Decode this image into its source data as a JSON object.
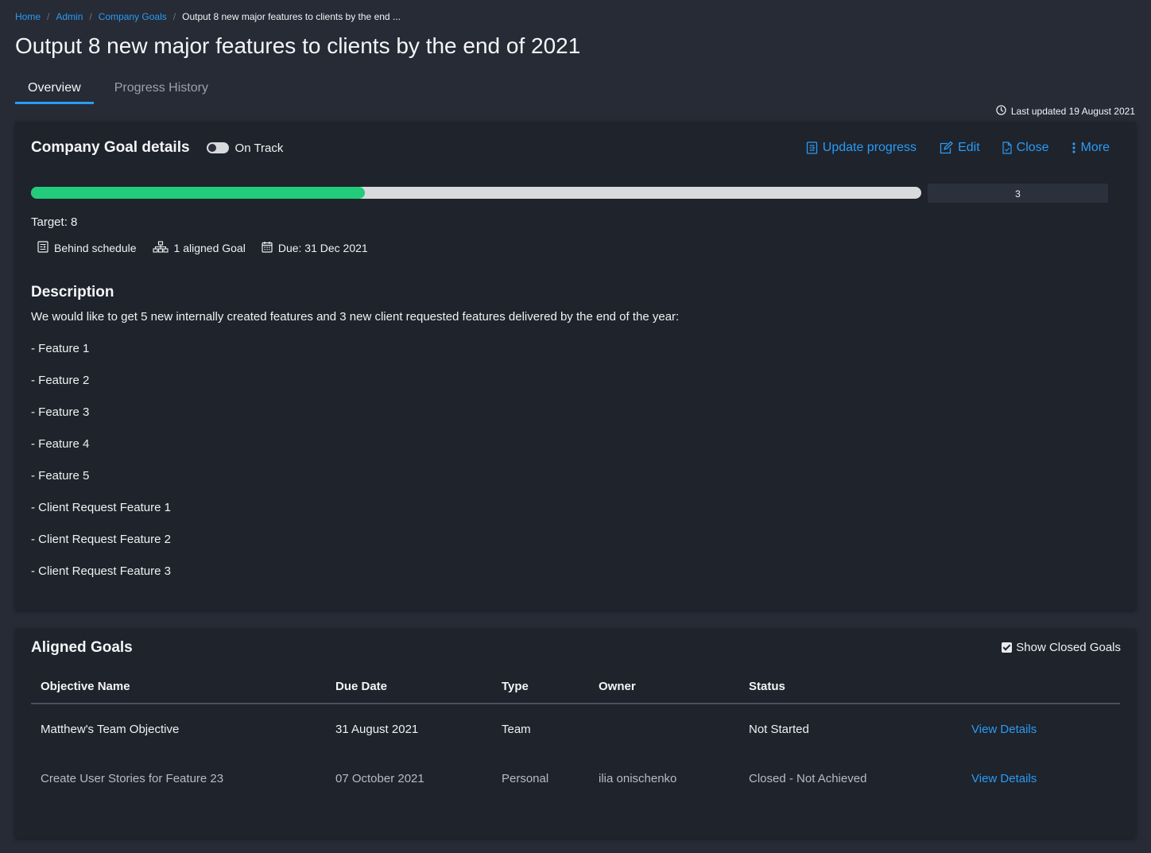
{
  "breadcrumb": {
    "home": "Home",
    "admin": "Admin",
    "company_goals": "Company Goals",
    "current": "Output 8 new major features to clients by the end ..."
  },
  "title": "Output 8 new major features to clients by the end of 2021",
  "tabs": [
    {
      "label": "Overview",
      "active": true
    },
    {
      "label": "Progress History",
      "active": false
    }
  ],
  "last_updated": "Last updated 19 August 2021",
  "details": {
    "title": "Company Goal details",
    "status_toggle_label": "On Track",
    "actions": {
      "update_progress": "Update progress",
      "edit": "Edit",
      "close": "Close",
      "more": "More"
    },
    "progress": {
      "current": "3",
      "target": 8,
      "fraction": 0.375,
      "fill_color": "#22cc7a"
    },
    "target_label": "Target: 8",
    "meta": {
      "schedule": "Behind schedule",
      "aligned": "1 aligned Goal",
      "due": "Due: 31 Dec 2021"
    },
    "description": {
      "title": "Description",
      "intro": "We would like to get 5 new internally created features and 3 new client requested features delivered by the end of the year:",
      "items": [
        "- Feature 1",
        "- Feature 2",
        "- Feature 3",
        "- Feature 4",
        "- Feature 5",
        "- Client Request Feature 1",
        "- Client Request Feature 2",
        "- Client Request Feature 3"
      ]
    }
  },
  "aligned": {
    "title": "Aligned Goals",
    "show_closed_label": "Show Closed Goals",
    "show_closed_checked": true,
    "columns": {
      "name": "Objective Name",
      "due": "Due Date",
      "type": "Type",
      "owner": "Owner",
      "status": "Status"
    },
    "rows": [
      {
        "name": "Matthew's Team Objective",
        "due": "31 August 2021",
        "type": "Team",
        "owner": "",
        "status": "Not Started",
        "link": "View Details"
      },
      {
        "name": "Create User Stories for Feature 23",
        "due": "07 October 2021",
        "type": "Personal",
        "owner": "ilia onischenko",
        "status": "Closed - Not Achieved",
        "link": "View Details"
      }
    ]
  },
  "colors": {
    "accent": "#2b9bf4",
    "background": "#262b36",
    "card": "#1e232c",
    "progress_track": "#d9dadd"
  }
}
